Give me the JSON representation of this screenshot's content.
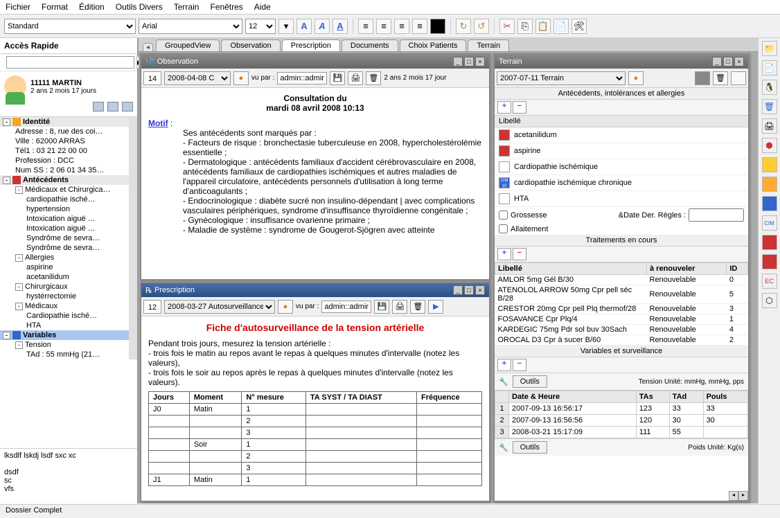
{
  "menubar": [
    "Fichier",
    "Format",
    "Édition",
    "Outils Divers",
    "Terrain",
    "Fenêtres",
    "Aide"
  ],
  "toolbar": {
    "style": "Standard",
    "font": "Arial",
    "size": "12"
  },
  "sidebar": {
    "quick_title": "Accès Rapide",
    "patient_name": "11111 MARTIN",
    "patient_age": "2 ans 2 mois 17 jours",
    "tree": {
      "identite": {
        "label": "Identité",
        "fields": [
          "Adresse : 8, rue des coi…",
          "Ville : 62000 ARRAS",
          "Tél1 : 03 21 22 00 00",
          "Profession : DCC",
          "Num SS : 2 06 01 34 35…"
        ]
      },
      "antecedents": {
        "label": "Antécédents",
        "groups": [
          {
            "label": "Médicaux et Chirurgica…",
            "items": [
              "cardiopathie isché…",
              "hypertension",
              "Intoxication aiguë …",
              "Intoxication aiguë …",
              "Syndrôme de sevra…",
              "Syndrôme de sevra…"
            ]
          },
          {
            "label": "Allergies",
            "items": [
              "aspirine",
              "acetanilidum"
            ]
          },
          {
            "label": "Chirurgicaux",
            "items": [
              "hystérrectomie"
            ]
          },
          {
            "label": "Médicaux",
            "items": [
              "Cardiopathie isché…",
              "HTA"
            ]
          }
        ]
      },
      "variables": {
        "label": "Variables",
        "groups": [
          {
            "label": "Tension",
            "items": [
              "TAd : 55 mmHg (21…"
            ]
          }
        ]
      }
    },
    "notes": "lksdlf lskdj lsdf sxc xc\n\ndsdf\nsc\nvfs"
  },
  "tabs": [
    "GroupedView",
    "Observation",
    "Prescription",
    "Documents",
    "Choix Patients",
    "Terrain"
  ],
  "active_tab": "Prescription",
  "observation": {
    "win_title": "Observation",
    "count": "14",
    "date_sel": "2008-04-08 C",
    "vu_par": "vu par :",
    "user": "admin::admin",
    "age_note": "2 ans 2 mois 17 jour",
    "title1": "Consultation du",
    "title2": "mardi 08 avril 2008 10:13",
    "motif_label": "Motif",
    "body_lines": [
      "Ses antécédents sont marqués par :",
      "- Facteurs de risque :  bronchectasie tuberculeuse en 2008, hypercholestérolémie essentielle ;",
      "- Dermatologique :  antécédents familiaux d'accident cérébrovasculaire en 2008, antécédents familiaux de cardiopathies ischémiques et autres maladies de l'appareil circulatoire, antécédents personnels d'utilisation à long terme d'anticoagulants ;",
      "- Endocrinologique :  diabète sucré non insulino-dépendant | avec complications vasculaires périphériques, syndrome d'insuffisance thyroïdienne congénitale ;",
      "- Gynécologique :  insuffisance ovarienne primaire ;",
      "- Maladie de système :  syndrome de Gougerot-Sjögren avec atteinte"
    ]
  },
  "prescription": {
    "win_title": "Prescription",
    "count": "12",
    "date_sel": "2008-03-27 Autosurveillance",
    "vu_par": "vu par :",
    "user": "admin::admin",
    "title": "Fiche d'autosurveillance de la tension artérielle",
    "intro": [
      "Pendant trois jours, mesurez la tension artérielle :",
      "- trois fois le matin au repos avant le repas à quelques minutes d'intervalle (notez les valeurs),",
      "- trois fois le soir au repos après le repas à quelques minutes d'intervalle (notez les valeurs)."
    ],
    "table": {
      "headers": [
        "Jours",
        "Moment",
        "N° mesure",
        "TA SYST / TA DIAST",
        "Fréquence"
      ],
      "rows": [
        [
          "J0",
          "Matin",
          "1",
          "",
          ""
        ],
        [
          "",
          "",
          "2",
          "",
          ""
        ],
        [
          "",
          "",
          "3",
          "",
          ""
        ],
        [
          "",
          "Soir",
          "1",
          "",
          ""
        ],
        [
          "",
          "",
          "2",
          "",
          ""
        ],
        [
          "",
          "",
          "3",
          "",
          ""
        ],
        [
          "J1",
          "Matin",
          "1",
          "",
          ""
        ]
      ]
    }
  },
  "terrain": {
    "win_title": "Terrain",
    "date_sel": "2007-07-11 Terrain",
    "sections": {
      "ant_title": "Antécédents, intolérances et allergies",
      "libelle_hdr": "Libellé",
      "ant_items": [
        {
          "icon": "red",
          "label": "acetanilidum"
        },
        {
          "icon": "red",
          "label": "aspirine"
        },
        {
          "icon": "plain",
          "label": "Cardiopathie ischémique"
        },
        {
          "icon": "cim",
          "label": "cardiopathie ischémique chronique"
        },
        {
          "icon": "plain",
          "label": "HTA"
        }
      ],
      "grossesse": "Grossesse",
      "date_regles": "&Date Der. Règles :",
      "allaitement": "Allaitement",
      "trait_title": "Traitements en cours",
      "trait_headers": [
        "Libellé",
        "à renouveler",
        "ID"
      ],
      "trait_rows": [
        [
          "AMLOR 5mg Gél B/30",
          "Renouvelable",
          "0"
        ],
        [
          "ATENOLOL ARROW 50mg Cpr pell séc B/28",
          "Renouvelable",
          "5"
        ],
        [
          "CRESTOR 20mg Cpr pell Plq thermof/28",
          "Renouvelable",
          "3"
        ],
        [
          "FOSAVANCE Cpr Plq/4",
          "Renouvelable",
          "1"
        ],
        [
          "KARDEGIC 75mg Pdr sol buv 30Sach",
          "Renouvelable",
          "4"
        ],
        [
          "OROCAL D3 Cpr à sucer B/60",
          "Renouvelable",
          "2"
        ]
      ],
      "var_title": "Variables et surveillance",
      "outils": "Outils",
      "tension_note": "Tension  Unité: mmHg,  mmHg,  pps",
      "var_headers": [
        "",
        "Date & Heure",
        "TAs",
        "TAd",
        "Pouls"
      ],
      "var_rows": [
        [
          "1",
          "2007-09-13  16:56:17",
          "123",
          "33",
          "33"
        ],
        [
          "2",
          "2007-09-13  16:56:56",
          "120",
          "30",
          "30"
        ],
        [
          "3",
          "2008-03-21  15:17:09",
          "111",
          "55",
          ""
        ]
      ],
      "poids_note": "Poids  Unité: Kg(s)"
    }
  },
  "statusbar": "Dossier Complet"
}
